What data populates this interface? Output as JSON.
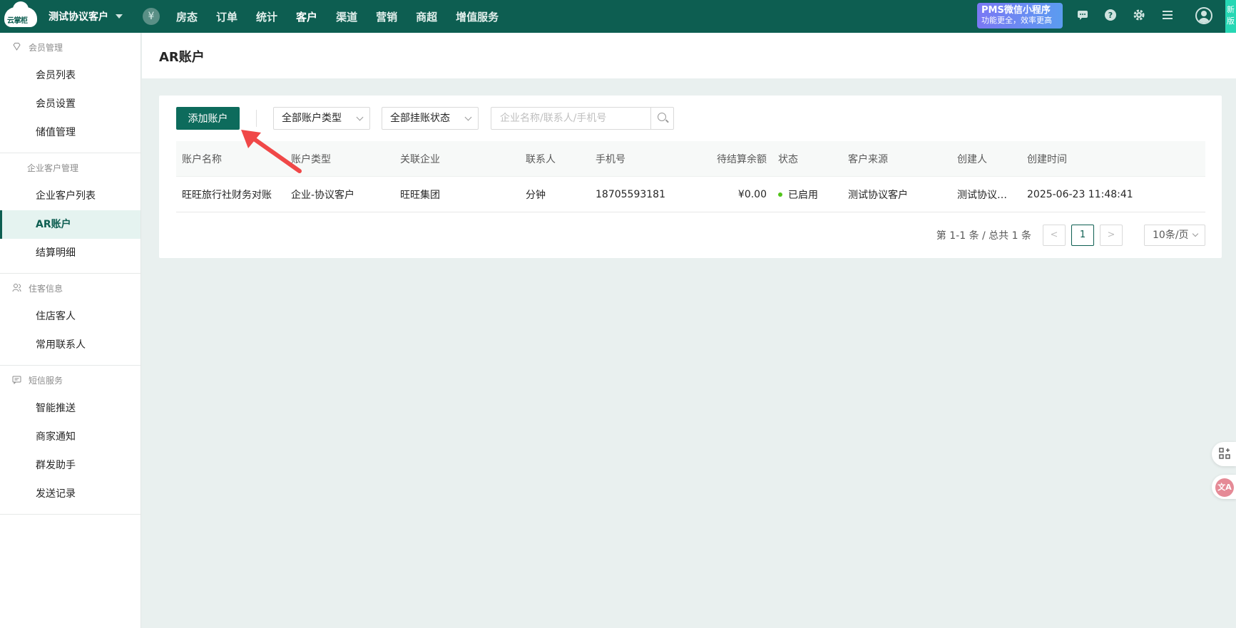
{
  "topbar": {
    "logo_text": "云掌柜",
    "hotel_name": "测试协议客户",
    "currency_symbol": "¥",
    "nav": [
      {
        "label": "房态"
      },
      {
        "label": "订单"
      },
      {
        "label": "统计"
      },
      {
        "label": "客户"
      },
      {
        "label": "渠道"
      },
      {
        "label": "营销"
      },
      {
        "label": "商超"
      },
      {
        "label": "增值服务"
      }
    ],
    "active_nav": "客户",
    "promo_line1": "PMS微信小程序",
    "promo_line2": "功能更全，效率更高",
    "new_badge": "新版",
    "icons": [
      "message-icon",
      "help-icon",
      "gear-icon",
      "menu-icon",
      "avatar-icon"
    ]
  },
  "sidebar": {
    "groups": [
      {
        "title": "会员管理",
        "icon": "diamond-icon",
        "items": [
          "会员列表",
          "会员设置",
          "储值管理"
        ]
      },
      {
        "title": "企业客户管理",
        "icon": "",
        "items": [
          "企业客户列表",
          "AR账户",
          "结算明细"
        ]
      },
      {
        "title": "住客信息",
        "icon": "users-icon",
        "items": [
          "住店客人",
          "常用联系人"
        ]
      },
      {
        "title": "短信服务",
        "icon": "sms-icon",
        "items": [
          "智能推送",
          "商家通知",
          "群发助手",
          "发送记录"
        ]
      }
    ],
    "active_item": "AR账户"
  },
  "page": {
    "title": "AR账户"
  },
  "toolbar": {
    "add_label": "添加账户",
    "account_type_select": "全部账户类型",
    "status_select": "全部挂账状态",
    "search_placeholder": "企业名称/联系人/手机号",
    "search_value": ""
  },
  "table": {
    "columns": [
      "账户名称",
      "账户类型",
      "关联企业",
      "联系人",
      "手机号",
      "待结算余额",
      "状态",
      "客户来源",
      "创建人",
      "创建时间"
    ],
    "rows": [
      {
        "account_name": "旺旺旅行社财务对账",
        "account_type": "企业-协议客户",
        "company": "旺旺集团",
        "contact": "分钟",
        "phone": "18705593181",
        "balance": "¥0.00",
        "status": "已启用",
        "source": "测试协议客户",
        "creator": "测试协议客...",
        "created_at": "2025-06-23 11:48:41"
      }
    ],
    "status_color": "#52c41a"
  },
  "pagination": {
    "total_text": "第 1-1 条 / 总共 1 条",
    "prev": "<",
    "current_page": "1",
    "next": ">",
    "page_size": "10条/页"
  },
  "floating": {
    "apps_icon": "apps-icon",
    "translate_label": "文A"
  },
  "colors": {
    "brand": "#0d5e51",
    "annotation_arrow": "#f04848"
  }
}
